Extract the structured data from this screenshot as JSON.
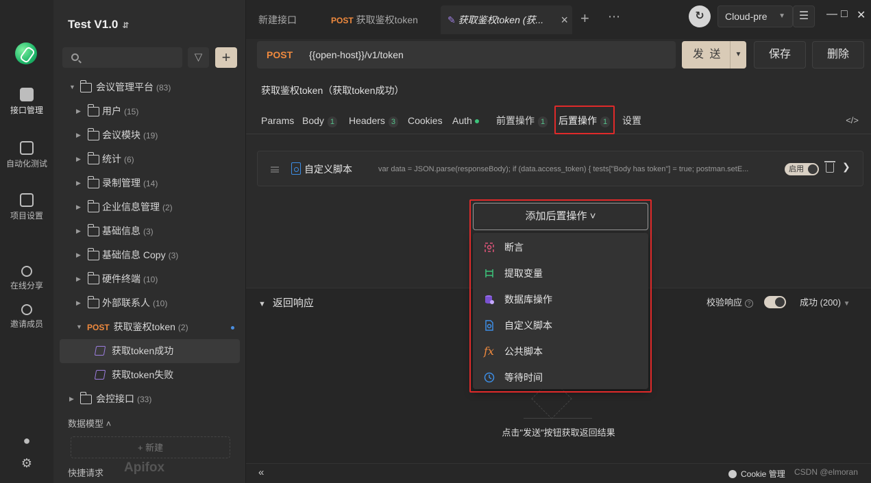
{
  "rail": {
    "items": [
      {
        "label": "接口管理"
      },
      {
        "label": "自动化测试"
      },
      {
        "label": "项目设置"
      },
      {
        "label": "在线分享"
      },
      {
        "label": "邀请成员"
      }
    ]
  },
  "sidebar": {
    "project": "Test V1.0",
    "tree": [
      {
        "label": "会议管理平台",
        "count": "(83)"
      },
      {
        "label": "用户",
        "count": "(15)"
      },
      {
        "label": "会议模块",
        "count": "(19)"
      },
      {
        "label": "统计",
        "count": "(6)"
      },
      {
        "label": "录制管理",
        "count": "(14)"
      },
      {
        "label": "企业信息管理",
        "count": "(2)"
      },
      {
        "label": "基础信息",
        "count": "(3)"
      },
      {
        "label": "基础信息 Copy",
        "count": "(3)"
      },
      {
        "label": "硬件终端",
        "count": "(10)"
      },
      {
        "label": "外部联系人",
        "count": "(10)"
      },
      {
        "method": "POST",
        "label": "获取鉴权token",
        "count": "(2)"
      },
      {
        "label": "获取token成功"
      },
      {
        "label": "获取token失败"
      },
      {
        "label": "会控接口",
        "count": "(33)"
      }
    ],
    "data_model": "数据模型",
    "new_btn": "+ 新建",
    "quick_request": "快捷请求",
    "watermark": "Apifox"
  },
  "tabs": [
    {
      "label": "新建接口"
    },
    {
      "method": "POST",
      "label": "获取鉴权token"
    },
    {
      "label": "获取鉴权token (获..."
    }
  ],
  "env": {
    "name": "Cloud-pre"
  },
  "request": {
    "method": "POST",
    "url": "{{open-host}}/v1/token",
    "send": "发 送",
    "save": "保存",
    "delete": "删除",
    "name": "获取鉴权token（获取token成功）"
  },
  "subtabs": [
    {
      "label": "Params"
    },
    {
      "label": "Body",
      "badge": "1"
    },
    {
      "label": "Headers",
      "badge": "3"
    },
    {
      "label": "Cookies"
    },
    {
      "label": "Auth"
    },
    {
      "label": "前置操作",
      "badge": "1"
    },
    {
      "label": "后置操作",
      "badge": "1"
    },
    {
      "label": "设置"
    }
  ],
  "script": {
    "name": "自定义脚本",
    "code": "var data = JSON.parse(responseBody); if (data.access_token) { tests[\"Body has token\"] = true; postman.setE...",
    "toggle": "启用"
  },
  "add_post": {
    "label": "添加后置操作 ˅",
    "items": [
      {
        "label": "断言",
        "color": "#e0547a"
      },
      {
        "label": "提取变量",
        "color": "#3cc37a"
      },
      {
        "label": "数据库操作",
        "color": "#9b6ef0"
      },
      {
        "label": "自定义脚本",
        "color": "#3d8ee6"
      },
      {
        "label": "公共脚本",
        "color": "#f08a3e"
      },
      {
        "label": "等待时间",
        "color": "#3d8ee6"
      }
    ]
  },
  "response": {
    "title": "返回响应",
    "verify": "校验响应",
    "status": "成功 (200)",
    "hint": "点击\"发送\"按钮获取返回结果"
  },
  "footer": {
    "cookie": "Cookie 管理",
    "watermark": "CSDN @elmoran"
  }
}
